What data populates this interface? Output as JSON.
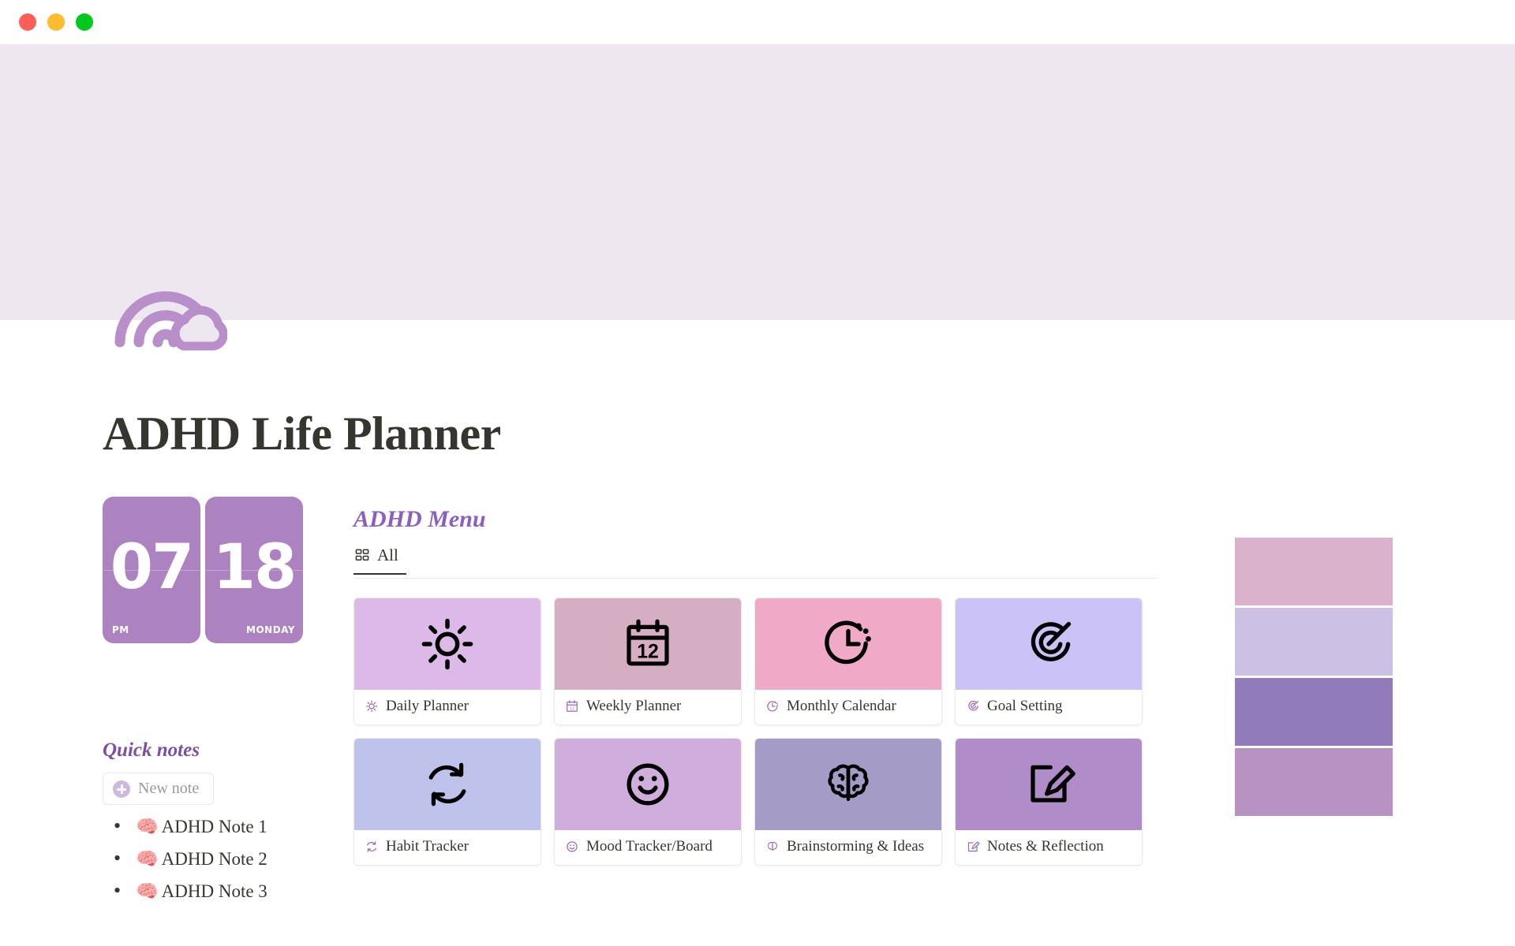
{
  "window": {
    "traffic_lights": [
      {
        "name": "close",
        "color": "#FF5F57"
      },
      {
        "name": "minimize",
        "color": "#FEBC2E"
      },
      {
        "name": "maximize",
        "color": "#00C91E"
      }
    ]
  },
  "cover": {
    "background_color": "#EDE8F0",
    "icon": "rainbow-cloud-icon",
    "icon_color": "#B98FC9"
  },
  "header": {
    "title": "ADHD Life Planner"
  },
  "clock": {
    "hour": "07",
    "meridiem": "PM",
    "day_number": "18",
    "weekday": "MONDAY",
    "card_color": "#AC82C0"
  },
  "quick_notes": {
    "title": "Quick notes",
    "new_note_label": "New note",
    "new_note_icon": "plus-circle-icon",
    "items": [
      {
        "emoji": "🧠",
        "label": "ADHD Note 1"
      },
      {
        "emoji": "🧠",
        "label": "ADHD Note 2"
      },
      {
        "emoji": "🧠",
        "label": "ADHD Note 3"
      }
    ]
  },
  "menu": {
    "heading": "ADHD Menu",
    "heading_color": "#8B5FBF",
    "tabs": [
      {
        "label": "All",
        "icon": "grid-view-icon",
        "active": true
      }
    ],
    "cards": [
      {
        "label": "Daily Planner",
        "icon": "sun-icon",
        "cover_color": "#DCB9E7"
      },
      {
        "label": "Weekly Planner",
        "icon": "calendar-12-icon",
        "cover_color": "#D6AEC4"
      },
      {
        "label": "Monthly Calendar",
        "icon": "clock-dotted-icon",
        "cover_color": "#F0A9C6"
      },
      {
        "label": "Goal Setting",
        "icon": "target-arrow-icon",
        "cover_color": "#CBC2F7"
      },
      {
        "label": "Habit Tracker",
        "icon": "refresh-icon",
        "cover_color": "#BFC3EC"
      },
      {
        "label": "Mood Tracker/Board",
        "icon": "smiley-icon",
        "cover_color": "#CFAEDC"
      },
      {
        "label": "Brainstorming & Ideas",
        "icon": "brain-icon",
        "cover_color": "#A49CC7"
      },
      {
        "label": "Notes & Reflection",
        "icon": "note-edit-icon",
        "cover_color": "#B08CC9"
      }
    ]
  },
  "swatches": [
    {
      "name": "swatch-pink-rose",
      "color": "#DBB2CC"
    },
    {
      "name": "swatch-lilac-light",
      "color": "#CDC0E5"
    },
    {
      "name": "swatch-purple-deep",
      "color": "#917BBB"
    },
    {
      "name": "swatch-mauve",
      "color": "#B792C2"
    }
  ]
}
